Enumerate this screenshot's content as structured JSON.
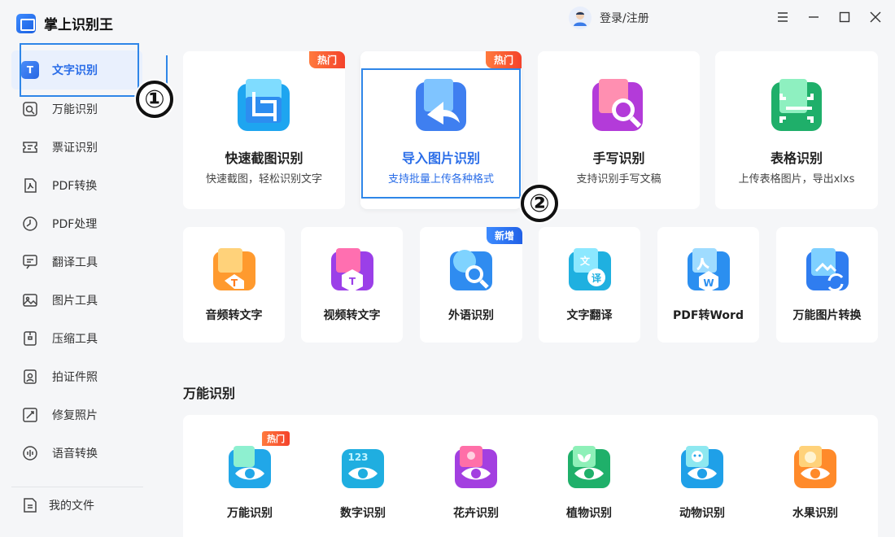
{
  "app": {
    "title": "掌上识别王"
  },
  "sidebar": {
    "items": [
      {
        "label": "文字识别",
        "icon": "text-recognition-icon",
        "active": true
      },
      {
        "label": "万能识别",
        "icon": "scan-search-icon"
      },
      {
        "label": "票证识别",
        "icon": "ticket-icon"
      },
      {
        "label": "PDF转换",
        "icon": "pdf-convert-icon"
      },
      {
        "label": "PDF处理",
        "icon": "pdf-process-icon"
      },
      {
        "label": "翻译工具",
        "icon": "translate-icon"
      },
      {
        "label": "图片工具",
        "icon": "image-icon"
      },
      {
        "label": "压缩工具",
        "icon": "compress-icon"
      },
      {
        "label": "拍证件照",
        "icon": "id-photo-icon"
      },
      {
        "label": "修复照片",
        "icon": "repair-photo-icon"
      },
      {
        "label": "语音转换",
        "icon": "voice-icon"
      }
    ],
    "my_files": "我的文件"
  },
  "header": {
    "login": "登录/注册"
  },
  "annotations": {
    "one": "①",
    "two": "②"
  },
  "top_cards": [
    {
      "title": "快速截图识别",
      "desc": "快速截图，轻松识别文字",
      "badge": "热门",
      "icon": "screenshot-icon"
    },
    {
      "title": "导入图片识别",
      "desc": "支持批量上传各种格式",
      "badge": "热门",
      "icon": "import-image-icon"
    },
    {
      "title": "手写识别",
      "desc": "支持识别手写文稿",
      "icon": "handwriting-icon"
    },
    {
      "title": "表格识别",
      "desc": "上传表格图片，导出xlxs",
      "icon": "table-icon"
    }
  ],
  "mid_cards": [
    {
      "title": "音频转文字",
      "icon": "audio-to-text-icon"
    },
    {
      "title": "视频转文字",
      "icon": "video-to-text-icon"
    },
    {
      "title": "外语识别",
      "badge": "新增",
      "icon": "foreign-language-icon"
    },
    {
      "title": "文字翻译",
      "icon": "text-translate-icon"
    },
    {
      "title": "PDF转Word",
      "icon": "pdf-to-word-icon"
    },
    {
      "title": "万能图片转换",
      "icon": "image-convert-icon"
    }
  ],
  "section": {
    "title": "万能识别",
    "items": [
      {
        "label": "万能识别",
        "badge": "热门",
        "icon": "universal-eye-icon"
      },
      {
        "label": "数字识别",
        "icon": "number-eye-icon"
      },
      {
        "label": "花卉识别",
        "icon": "flower-eye-icon"
      },
      {
        "label": "植物识别",
        "icon": "plant-eye-icon"
      },
      {
        "label": "动物识别",
        "icon": "animal-eye-icon"
      },
      {
        "label": "水果识别",
        "icon": "fruit-eye-icon"
      }
    ]
  },
  "colors": {
    "accent": "#2a6de8",
    "hot": "#f4422b",
    "new": "#2060e6",
    "annotation": "#2f86e8"
  }
}
